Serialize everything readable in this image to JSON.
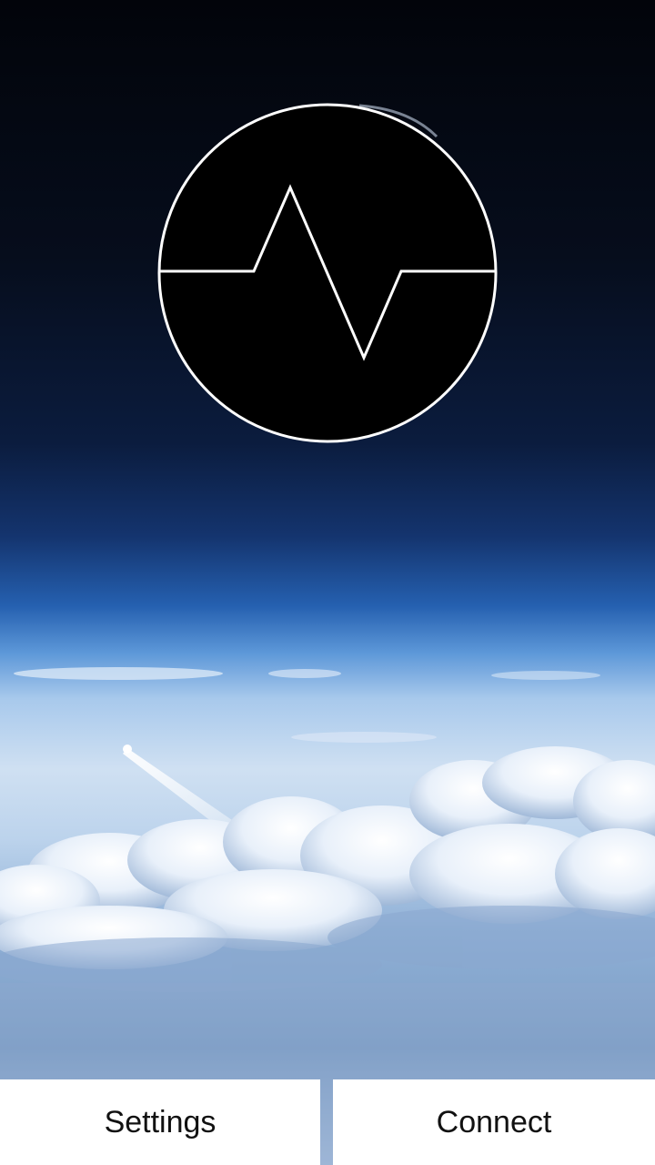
{
  "app": {
    "logo_icon": "heartbeat-pulse-icon",
    "background": "earth-atmosphere-clouds-photo"
  },
  "bottom_bar": {
    "settings_label": "Settings",
    "connect_label": "Connect"
  },
  "colors": {
    "logo_fill": "#000000",
    "logo_stroke": "#ffffff",
    "button_bg": "#ffffff",
    "button_text": "#111111"
  }
}
